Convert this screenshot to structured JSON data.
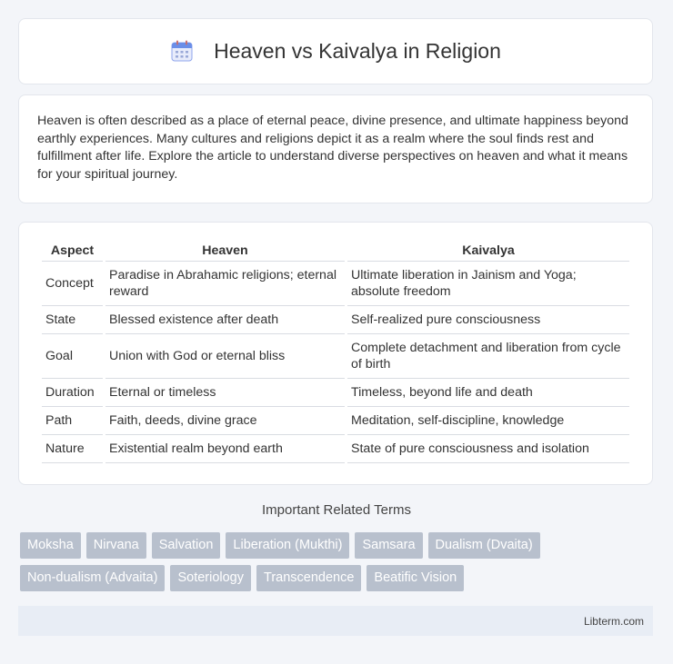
{
  "header": {
    "title": "Heaven vs Kaivalya in Religion",
    "icon": "calendar-icon"
  },
  "intro": {
    "text": "Heaven is often described as a place of eternal peace, divine presence, and ultimate happiness beyond earthly experiences. Many cultures and religions depict it as a realm where the soul finds rest and fulfillment after life. Explore the article to understand diverse perspectives on heaven and what it means for your spiritual journey."
  },
  "table": {
    "headers": [
      "Aspect",
      "Heaven",
      "Kaivalya"
    ],
    "rows": [
      [
        "Concept",
        "Paradise in Abrahamic religions; eternal reward",
        "Ultimate liberation in Jainism and Yoga; absolute freedom"
      ],
      [
        "State",
        "Blessed existence after death",
        "Self-realized pure consciousness"
      ],
      [
        "Goal",
        "Union with God or eternal bliss",
        "Complete detachment and liberation from cycle of birth"
      ],
      [
        "Duration",
        "Eternal or timeless",
        "Timeless, beyond life and death"
      ],
      [
        "Path",
        "Faith, deeds, divine grace",
        "Meditation, self-discipline, knowledge"
      ],
      [
        "Nature",
        "Existential realm beyond earth",
        "State of pure consciousness and isolation"
      ]
    ]
  },
  "related": {
    "title": "Important Related Terms",
    "tags": [
      "Moksha",
      "Nirvana",
      "Salvation",
      "Liberation (Mukthi)",
      "Samsara",
      "Dualism (Dvaita)",
      "Non-dualism (Advaita)",
      "Soteriology",
      "Transcendence",
      "Beatific Vision"
    ]
  },
  "footer": {
    "brand": "Libterm.com"
  },
  "colors": {
    "background": "#f3f5f9",
    "tag_bg": "#b8c0cd",
    "footer_bg": "#e8edf5",
    "icon_blue": "#6a8ee8"
  }
}
